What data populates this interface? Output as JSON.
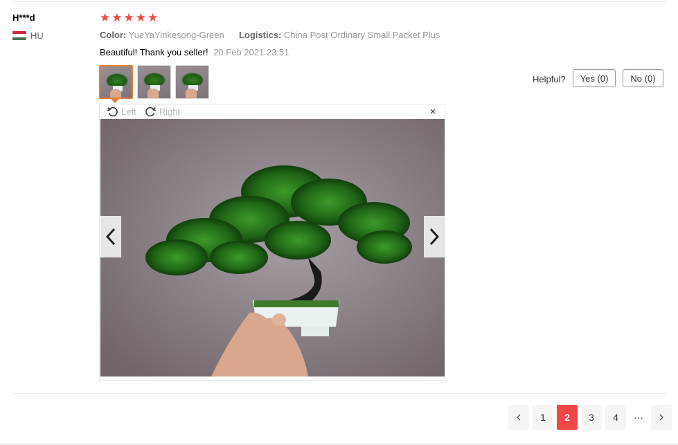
{
  "review": {
    "user": "H***d",
    "country_code": "HU",
    "rating": 5,
    "attributes": [
      {
        "label": "Color:",
        "value": "YueYaYinkesong-Green"
      },
      {
        "label": "Logistics:",
        "value": "China Post Ordinary Small Packet Plus"
      }
    ],
    "text": "Beautiful! Thank you seller!",
    "date": "20 Feb 2021 23:51",
    "star_icon": "star-icon",
    "flag_colors": [
      "#ce2939",
      "#ffffff",
      "#477050"
    ]
  },
  "helpful": {
    "label": "Helpful?",
    "yes": "Yes (0)",
    "no": "No (0)"
  },
  "viewer": {
    "rotate_left": "Left",
    "rotate_right": "Right",
    "close": "×"
  },
  "pager": {
    "pages": [
      "1",
      "2",
      "3",
      "4"
    ],
    "current": "2",
    "ellipsis": "···"
  },
  "colors": {
    "accent": "#f04645",
    "thumb_active": "#e5803b"
  }
}
